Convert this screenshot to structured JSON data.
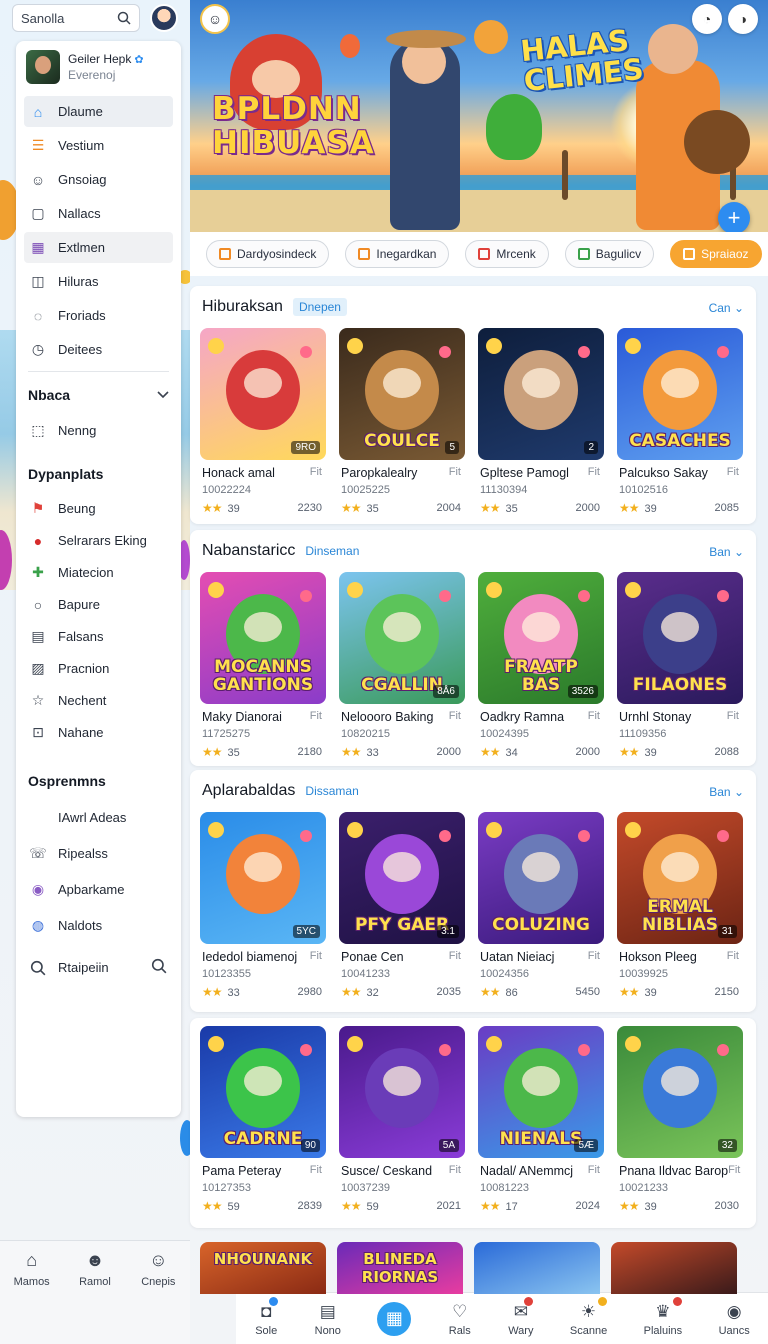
{
  "top": {
    "search_text": "Sanolla"
  },
  "profile": {
    "name": "Geiler Hepk",
    "sub": "Everenoj"
  },
  "sidebar": {
    "items": [
      {
        "label": "Dlaume",
        "icon": "home-icon",
        "color": "#2d8cf0"
      },
      {
        "label": "Vestium",
        "icon": "list-icon",
        "color": "#f08a24"
      },
      {
        "label": "Gnsoiag",
        "icon": "user-icon",
        "color": "#3b4350"
      },
      {
        "label": "Nallacs",
        "icon": "square-icon",
        "color": "#3b4350"
      },
      {
        "label": "Extlmen",
        "icon": "game-icon",
        "color": "#7b4bb5"
      },
      {
        "label": "Hiluras",
        "icon": "frame-icon",
        "color": "#3b4350"
      },
      {
        "label": "Froriads",
        "icon": "chat-icon",
        "color": "#3b4350"
      },
      {
        "label": "Deitees",
        "icon": "clock-icon",
        "color": "#3b4350"
      }
    ],
    "section1": "Nbaca",
    "section1_items": [
      {
        "label": "Nenng",
        "icon": "box-icon"
      }
    ],
    "section2": "Dypanplats",
    "section2_items": [
      {
        "label": "Beung",
        "icon": "flag-icon",
        "color": "#e0413a"
      },
      {
        "label": "Selrarars Eking",
        "icon": "red-ball-icon",
        "color": "#d62b2b"
      },
      {
        "label": "Miatecion",
        "icon": "plus-icon",
        "color": "#3aa14a"
      },
      {
        "label": "Bapure",
        "icon": "circle-icon",
        "color": "#3b4350"
      },
      {
        "label": "Falsans",
        "icon": "doc-icon",
        "color": "#3b4350"
      },
      {
        "label": "Pracnion",
        "icon": "image-icon",
        "color": "#3b4350"
      },
      {
        "label": "Nechent",
        "icon": "star-icon",
        "color": "#3b4350"
      },
      {
        "label": "Nahane",
        "icon": "bracket-icon",
        "color": "#3b4350"
      }
    ],
    "section3": "Osprenmns",
    "section3_items": [
      {
        "label": "IAwrl Adeas",
        "icon": ""
      },
      {
        "label": "Ripealss",
        "icon": "phone-icon",
        "color": "#3b4350"
      },
      {
        "label": "Apbarkame",
        "icon": "avatar-icon",
        "color": "#8a5cc4"
      },
      {
        "label": "Naldots",
        "icon": "globe-icon",
        "color": "#3a6ed8"
      }
    ],
    "search_label": "Rtaipeiin"
  },
  "hero": {
    "title_left": "BPLDNN HIBUASA",
    "title_right": "HALAS CLIMES"
  },
  "chips": [
    {
      "label": "Dardyosindeck",
      "color": "#f08a24"
    },
    {
      "label": "Inegardkan",
      "color": "#f08a24"
    },
    {
      "label": "Mrcenk",
      "color": "#e0413a"
    },
    {
      "label": "Bagulicv",
      "color": "#3aa14a"
    },
    {
      "label": "Spraiaoz",
      "color": "#ffffff"
    }
  ],
  "sections": [
    {
      "title": "Hiburaksan",
      "tag": "Dnepen",
      "more": "Can",
      "games": [
        {
          "name": "Honack amal",
          "fl": "Fit",
          "id": "10022224",
          "rating": "39",
          "count": "2230",
          "thumb_text": "",
          "badge": "9RO",
          "bg": [
            "#f5a6c7",
            "#ffd95a"
          ],
          "blob": "#d83b3b"
        },
        {
          "name": "Paropkalealry",
          "fl": "Fit",
          "id": "10025225",
          "rating": "35",
          "count": "2004",
          "thumb_text": "COULCE",
          "badge": "5",
          "bg": [
            "#3a2a1c",
            "#7a5a34"
          ],
          "blob": "#c48a4a"
        },
        {
          "name": "Gpltese Pamogl",
          "fl": "Fit",
          "id": "11130394",
          "rating": "35",
          "count": "2000",
          "thumb_text": "",
          "badge": "2",
          "bg": [
            "#0e1e3c",
            "#1f3a6c"
          ],
          "blob": "#caa07c"
        },
        {
          "name": "Palcukso Sakay",
          "fl": "Fit",
          "id": "10102516",
          "rating": "39",
          "count": "2085",
          "thumb_text": "CASACHES",
          "badge": "",
          "bg": [
            "#2a5ad8",
            "#5fa0f0"
          ],
          "blob": "#f39a3c"
        }
      ]
    },
    {
      "title": "Nabanstaricc",
      "tag": "Dinseman",
      "more": "Ban",
      "games": [
        {
          "name": "Maky Dianorai",
          "fl": "Fit",
          "id": "11725275",
          "rating": "35",
          "count": "2180",
          "thumb_text": "MOCANNS GANTIONS",
          "badge": "",
          "bg": [
            "#e44db2",
            "#8a3cc9"
          ],
          "blob": "#4cb84a"
        },
        {
          "name": "Neloooro Baking",
          "fl": "Fit",
          "id": "10820215",
          "rating": "33",
          "count": "2000",
          "thumb_text": "CGALLIN",
          "badge": "8Å6",
          "bg": [
            "#7cc4ef",
            "#3a9a5a"
          ],
          "blob": "#5cc45a"
        },
        {
          "name": "Oadkry Ramna",
          "fl": "Fit",
          "id": "10024395",
          "rating": "34",
          "count": "2000",
          "thumb_text": "FRAATP BAS",
          "badge": "3526",
          "bg": [
            "#4fae3c",
            "#2b7a2b"
          ],
          "blob": "#f28ac0"
        },
        {
          "name": "Urnhl Stonay",
          "fl": "Fit",
          "id": "11109356",
          "rating": "39",
          "count": "2088",
          "thumb_text": "FILAONES",
          "badge": "",
          "bg": [
            "#5a2d8c",
            "#2a1a5c"
          ],
          "blob": "#3c3f8a"
        }
      ]
    },
    {
      "title": "Aplarabaldas",
      "tag": "Dissaman",
      "more": "Ban",
      "games": [
        {
          "name": "Iededol biamenoj",
          "fl": "Fit",
          "id": "10123355",
          "rating": "33",
          "count": "2980",
          "thumb_text": "",
          "badge": "5YC",
          "bg": [
            "#2a8ce8",
            "#5ab6f5"
          ],
          "blob": "#f2833a"
        },
        {
          "name": "Ponae Cen",
          "fl": "Fit",
          "id": "10041233",
          "rating": "32",
          "count": "2035",
          "thumb_text": "PFY GAER",
          "badge": "3.1",
          "bg": [
            "#3b1f6c",
            "#1f1244"
          ],
          "blob": "#9a48d8"
        },
        {
          "name": "Uatan Nieiacj",
          "fl": "Fit",
          "id": "10024356",
          "rating": "86",
          "count": "5450",
          "thumb_text": "COLUZING",
          "badge": "",
          "bg": [
            "#7a3cc4",
            "#3a1a7c"
          ],
          "blob": "#6a7ab8"
        },
        {
          "name": "Hokson Pleeg",
          "fl": "Fit",
          "id": "10039925",
          "rating": "39",
          "count": "2150",
          "thumb_text": "ERMAL NIBLIAS",
          "badge": "31",
          "bg": [
            "#c44a2a",
            "#6c2414"
          ],
          "blob": "#f0a04a"
        }
      ]
    },
    {
      "title": "",
      "tag": "",
      "more": "",
      "games": [
        {
          "name": "Pama Peteray",
          "fl": "Fit",
          "id": "10127353",
          "rating": "59",
          "count": "2839",
          "thumb_text": "CADRNE",
          "badge": "90",
          "bg": [
            "#1a3aa8",
            "#3a7ae8"
          ],
          "blob": "#3cc44a"
        },
        {
          "name": "Susce/ Ceskand",
          "fl": "Fit",
          "id": "10037239",
          "rating": "59",
          "count": "2021",
          "thumb_text": "",
          "badge": "5A",
          "bg": [
            "#4a1a8c",
            "#8a3cd8"
          ],
          "blob": "#6a3cb8"
        },
        {
          "name": "Nadal/ ANemmcj",
          "fl": "Fit",
          "id": "10081223",
          "rating": "17",
          "count": "2024",
          "thumb_text": "NIENALS",
          "badge": "5Æ",
          "bg": [
            "#6a3cc4",
            "#3a9ae8"
          ],
          "blob": "#4cb84a"
        },
        {
          "name": "Pnana Ildvac Barop",
          "fl": "Fit",
          "id": "10021233",
          "rating": "39",
          "count": "2030",
          "thumb_text": "",
          "badge": "32",
          "bg": [
            "#3a8a3a",
            "#7ac45a"
          ],
          "blob": "#3a7ad8"
        }
      ]
    }
  ],
  "peek_row": [
    {
      "thumb_text": "NHOUNANK",
      "bg": [
        "#d8642a",
        "#8a2a14"
      ]
    },
    {
      "thumb_text": "BLINEDA RIORNAS",
      "bg": [
        "#6a2ab8",
        "#e83ca0"
      ]
    },
    {
      "thumb_text": "",
      "bg": [
        "#2a6ad8",
        "#8ac4f0"
      ]
    },
    {
      "thumb_text": "",
      "bg": [
        "#c44a2a",
        "#3a1a1a"
      ]
    }
  ],
  "left_nav": [
    {
      "label": "Mamos",
      "icon": "home-icon"
    },
    {
      "label": "Ramol",
      "icon": "smile-icon"
    },
    {
      "label": "Cnepis",
      "icon": "user-icon"
    }
  ],
  "bottom_bar": [
    {
      "label": "Sole",
      "icon": "bag-icon",
      "dot": "#2d8cf0"
    },
    {
      "label": "Nono",
      "icon": "doc-icon",
      "dot": ""
    },
    {
      "label": "",
      "icon": "grid-icon",
      "dot": ""
    },
    {
      "label": "Rals",
      "icon": "heart-icon",
      "dot": ""
    },
    {
      "label": "Wary",
      "icon": "megaphone-icon",
      "dot": "#e0413a"
    },
    {
      "label": "Scanne",
      "icon": "bulb-icon",
      "dot": "#f2b01e"
    },
    {
      "label": "Plaluins",
      "icon": "trophy-icon",
      "dot": "#e0413a"
    },
    {
      "label": "Uancs",
      "icon": "avatar-icon",
      "dot": ""
    }
  ]
}
